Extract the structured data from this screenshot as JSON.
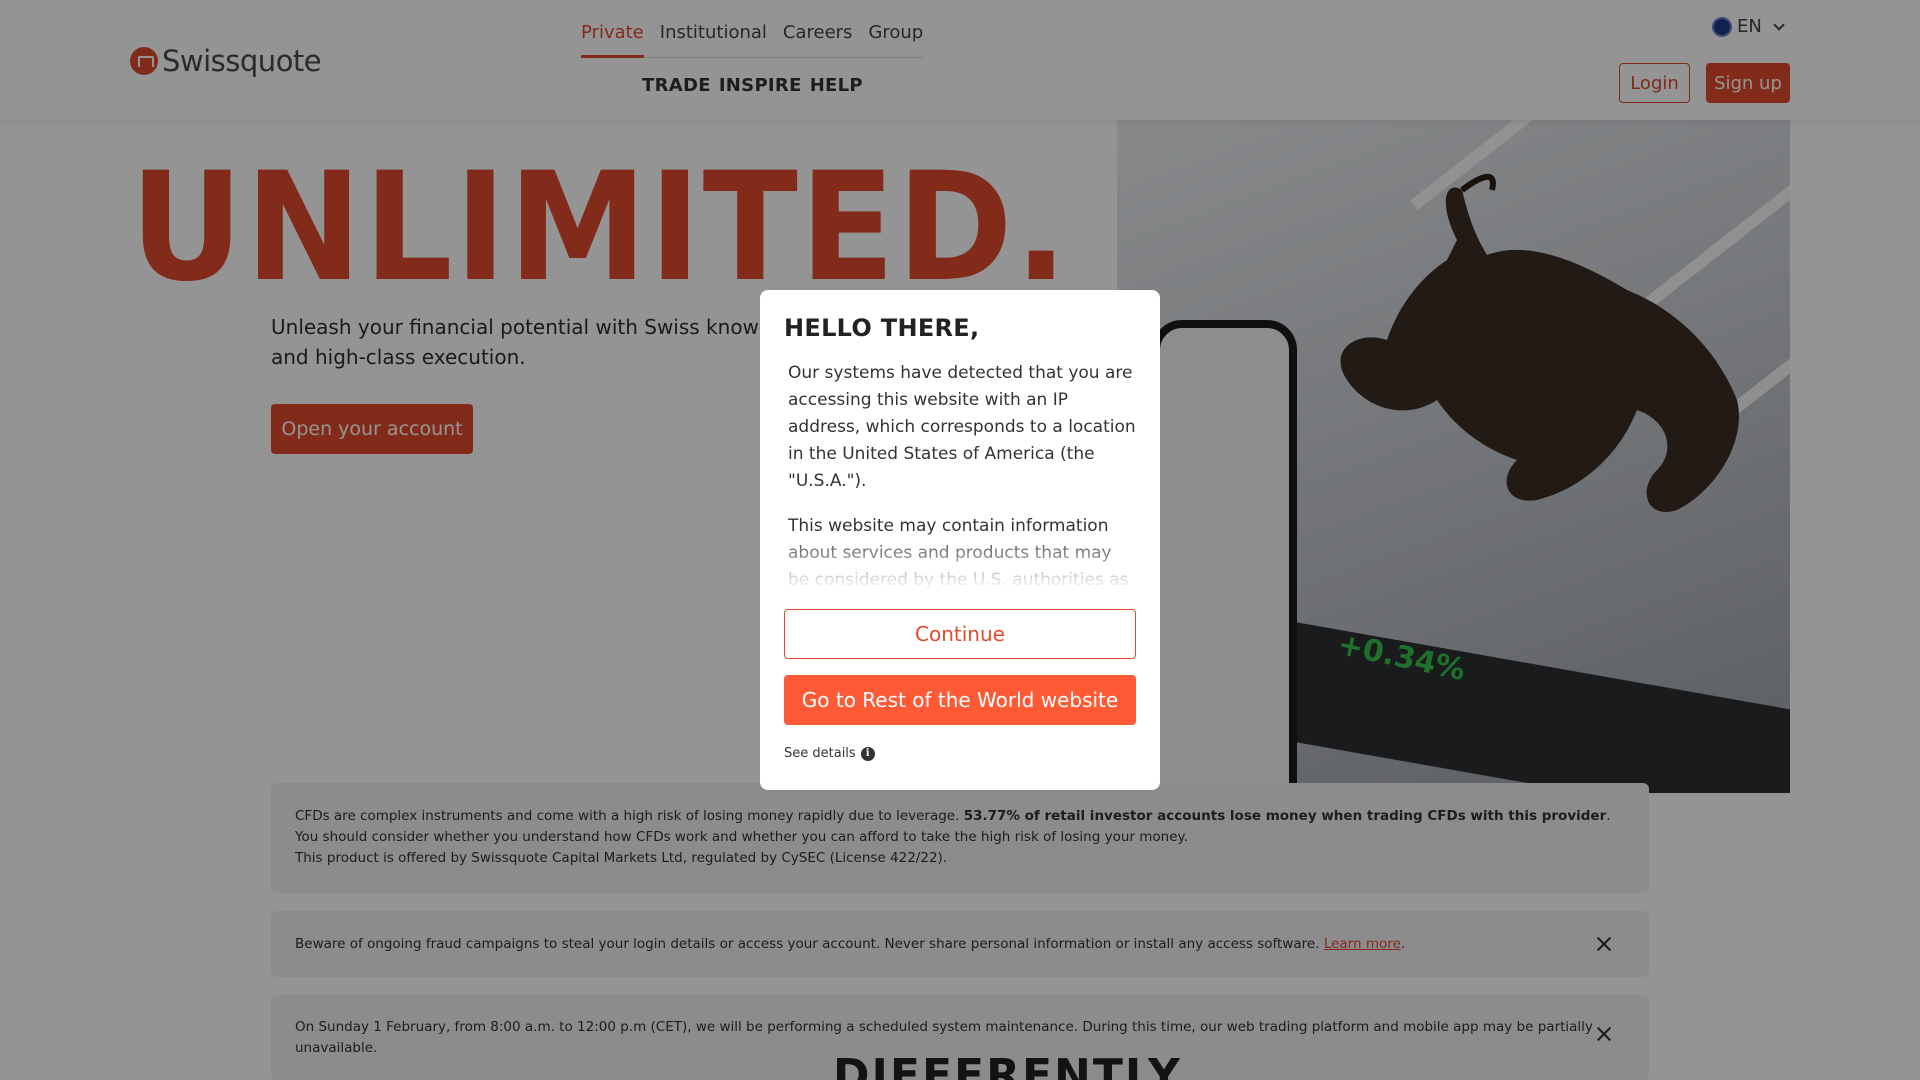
{
  "header": {
    "logo_text": "Swissquote",
    "top_nav": [
      "Private",
      "Institutional",
      "Careers",
      "Group"
    ],
    "sub_nav": [
      "TRADE",
      "INSPIRE",
      "HELP"
    ],
    "language": "EN",
    "login_label": "Login",
    "signup_label": "Sign up"
  },
  "hero": {
    "title": "UNLIMITED.",
    "subtitle": "Unleash your financial potential with Swiss know-how and high-class execution.",
    "cta_label": "Open your account",
    "ticker_text": "+0.34%"
  },
  "notices": {
    "cfd_text_1": "CFDs are complex instruments and come with a high risk of losing money rapidly due to leverage. ",
    "cfd_text_bold": "53.77% of retail investor accounts lose money when trading CFDs with this provider",
    "cfd_text_2": ". You should consider whether you understand how CFDs work and whether you can afford to take the high risk of losing your money.",
    "cfd_text_3": "This product is offered by Swissquote Capital Markets Ltd, regulated by CySEC (License 422/22).",
    "fraud_text": "Beware of ongoing fraud campaigns to steal your login details or access your account. Never share personal information or install any access software. ",
    "fraud_link": "Learn more",
    "maintenance_text": "On Sunday 1 February, from 8:00 a.m. to 12:00 p.m (CET), we will be performing a scheduled system maintenance. During this time, our web trading platform and mobile app may be partially unavailable.",
    "section_heading": "DIFFERENTLY"
  },
  "modal": {
    "title": "HELLO THERE,",
    "paragraph_1": "Our systems have detected that you are accessing this website with an IP address, which corresponds to a location in the United States of America (the \"U.S.A.\").",
    "paragraph_2": "This website may contain information about services and products that may be considered by the U.S. authorities as an",
    "continue_label": "Continue",
    "row_label": "Go to Rest of the World website",
    "details_label": "See details",
    "info_glyph": "i"
  },
  "colors": {
    "brand": "#e24a2e",
    "modal_button": "#ff5a36"
  }
}
